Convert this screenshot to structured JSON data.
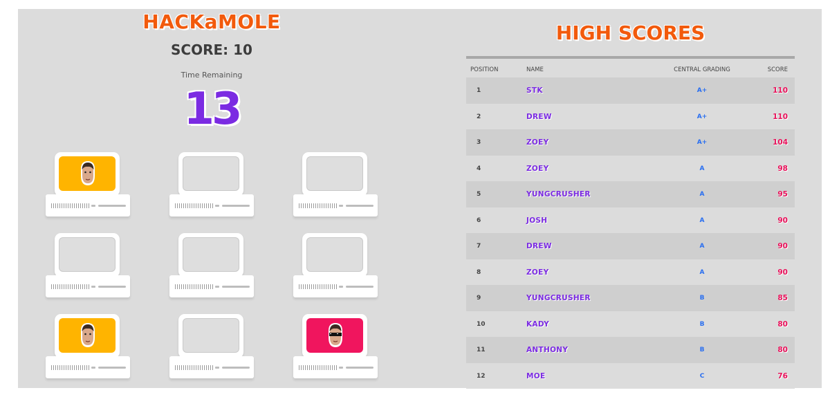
{
  "game": {
    "title": "HACKaMOLE",
    "score_text": "SCORE: 10",
    "score": 10,
    "time_label": "Time Remaining",
    "time_remaining": "13",
    "grid": [
      {
        "mole": "yellow-face"
      },
      {
        "mole": null
      },
      {
        "mole": null
      },
      {
        "mole": null
      },
      {
        "mole": null
      },
      {
        "mole": null
      },
      {
        "mole": "yellow-face"
      },
      {
        "mole": null
      },
      {
        "mole": "pink-sunglasses-face"
      }
    ]
  },
  "leaderboard": {
    "title": "HIGH SCORES",
    "headers": {
      "position": "POSITION",
      "name": "NAME",
      "grade": "CENTRAL GRADING",
      "score": "SCORE"
    },
    "rows": [
      {
        "position": "1",
        "name": "STK",
        "grade": "A+",
        "score": "110"
      },
      {
        "position": "2",
        "name": "DREW",
        "grade": "A+",
        "score": "110"
      },
      {
        "position": "3",
        "name": "ZOEY",
        "grade": "A+",
        "score": "104"
      },
      {
        "position": "4",
        "name": "ZOEY",
        "grade": "A",
        "score": "98"
      },
      {
        "position": "5",
        "name": "YUNGCRUSHER",
        "grade": "A",
        "score": "95"
      },
      {
        "position": "6",
        "name": "JOSH",
        "grade": "A",
        "score": "90"
      },
      {
        "position": "7",
        "name": "DREW",
        "grade": "A",
        "score": "90"
      },
      {
        "position": "8",
        "name": "ZOEY",
        "grade": "A",
        "score": "90"
      },
      {
        "position": "9",
        "name": "YUNGCRUSHER",
        "grade": "B",
        "score": "85"
      },
      {
        "position": "10",
        "name": "KADY",
        "grade": "B",
        "score": "80"
      },
      {
        "position": "11",
        "name": "ANTHONY",
        "grade": "B",
        "score": "80"
      },
      {
        "position": "12",
        "name": "MOE",
        "grade": "C",
        "score": "76"
      }
    ]
  },
  "colors": {
    "title_orange": "#f25a0c",
    "timer_purple": "#7b2be2",
    "name_purple": "#7b2be2",
    "grade_blue": "#2a6ff0",
    "score_pink": "#e8115a",
    "mole_yellow": "#ffb400",
    "mole_pink": "#f0155e",
    "background": "#dcdcdc"
  }
}
